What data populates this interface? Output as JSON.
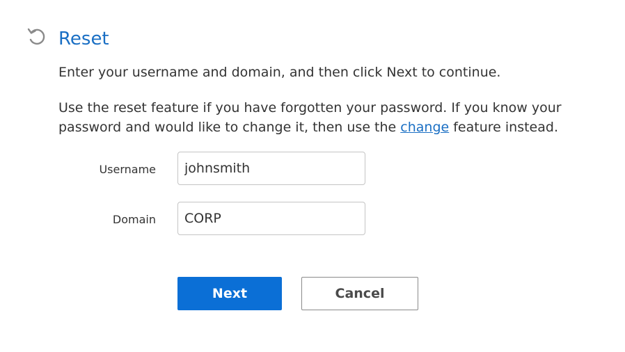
{
  "header": {
    "icon": "reset-icon",
    "title": "Reset"
  },
  "instructions": {
    "intro": "Enter your username and domain, and then click Next to continue.",
    "help_before_link": "Use the reset feature if you have forgotten your password. If you know your password and would like to change it, then use the ",
    "help_link": "change",
    "help_after_link": " feature instead."
  },
  "form": {
    "username": {
      "label": "Username",
      "value": "johnsmith"
    },
    "domain": {
      "label": "Domain",
      "value": "CORP"
    }
  },
  "actions": {
    "next_label": "Next",
    "cancel_label": "Cancel"
  },
  "colors": {
    "accent": "#1a6fc4",
    "primary_button": "#0b6fd6"
  }
}
